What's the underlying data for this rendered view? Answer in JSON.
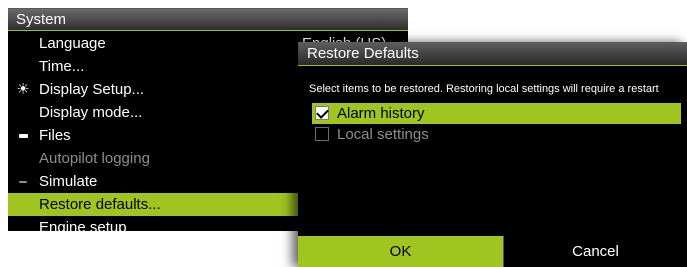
{
  "system_menu": {
    "title": "System",
    "items": [
      {
        "label": "Language",
        "value": "English (US)",
        "icon": "",
        "state": "normal"
      },
      {
        "label": "Time...",
        "value": "",
        "icon": "",
        "state": "normal"
      },
      {
        "label": "Display Setup...",
        "value": "",
        "icon": "sun-icon",
        "state": "normal"
      },
      {
        "label": "Display mode...",
        "value": "",
        "icon": "",
        "state": "normal"
      },
      {
        "label": "Files",
        "value": "",
        "icon": "files-icon",
        "state": "normal"
      },
      {
        "label": "Autopilot logging",
        "value": "",
        "icon": "",
        "state": "disabled"
      },
      {
        "label": "Simulate",
        "value": "",
        "icon": "simulate-icon",
        "state": "normal"
      },
      {
        "label": "Restore defaults...",
        "value": "",
        "icon": "",
        "state": "selected"
      },
      {
        "label": "Engine setup",
        "value": "",
        "icon": "",
        "state": "normal"
      }
    ]
  },
  "dialog": {
    "title": "Restore Defaults",
    "message": "Select items to be restored. Restoring local settings will require a restart",
    "options": [
      {
        "label": "Alarm history",
        "checked": true,
        "state": "selected"
      },
      {
        "label": "Local settings",
        "checked": false,
        "state": "disabled"
      }
    ],
    "ok_label": "OK",
    "cancel_label": "Cancel"
  },
  "colors": {
    "accent": "#a0c520",
    "background": "#000000",
    "disabled_text": "#8d8d8d"
  }
}
